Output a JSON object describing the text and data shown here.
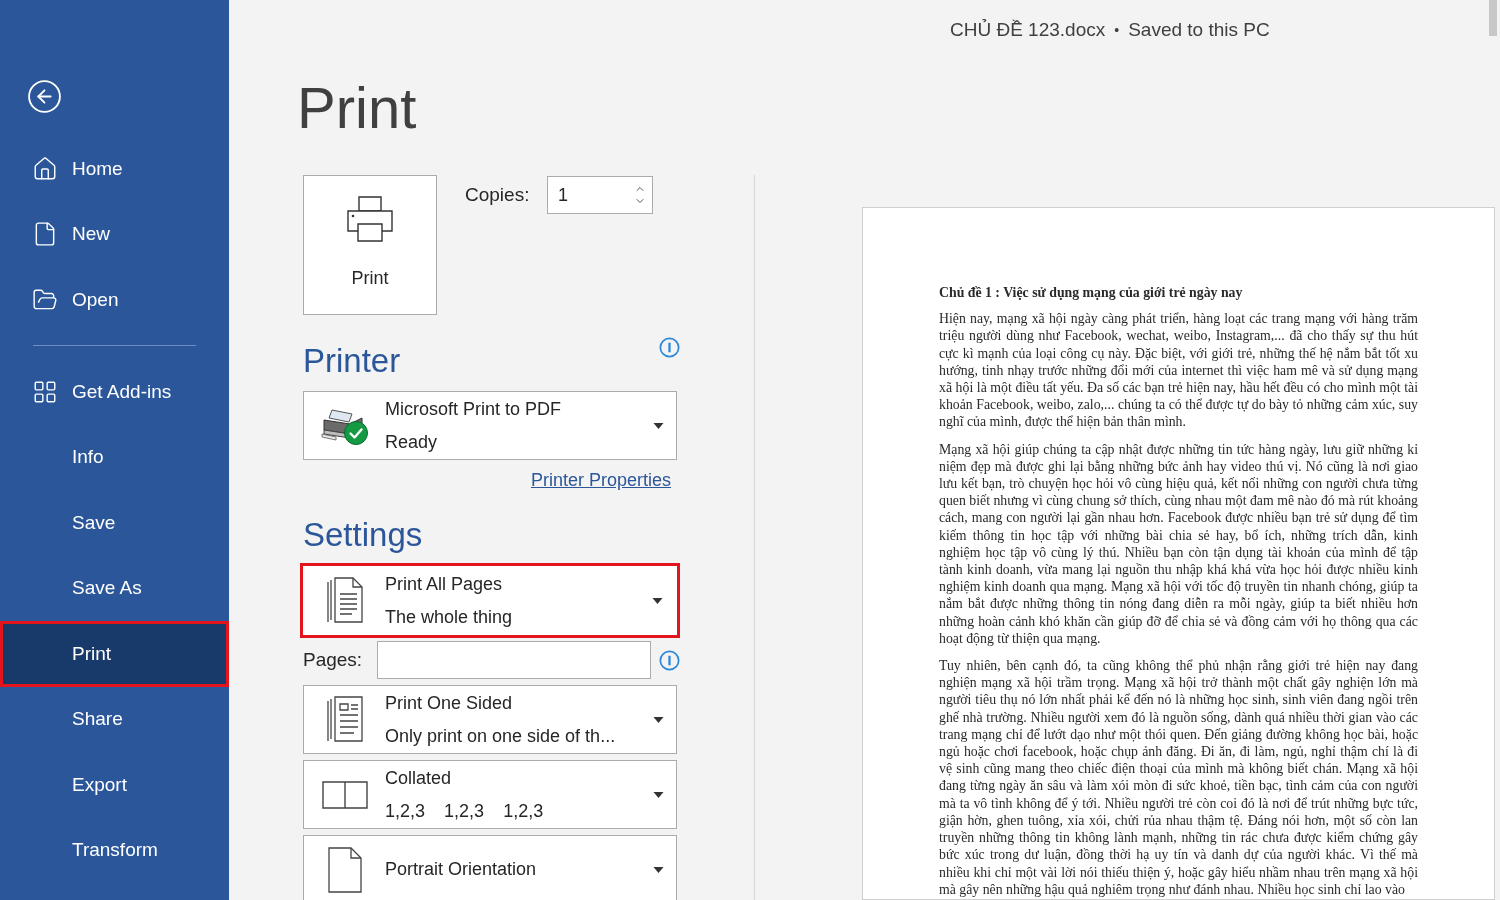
{
  "header": {
    "document_name": "CHỦ ĐỀ 123.docx",
    "separator": "•",
    "save_status": "Saved to this PC"
  },
  "sidebar": {
    "groups": [
      {
        "items": [
          {
            "kind": "home",
            "label": "Home",
            "selected": false,
            "highlighted": false
          },
          {
            "kind": "new",
            "label": "New",
            "selected": false,
            "highlighted": false
          },
          {
            "kind": "open",
            "label": "Open",
            "selected": false,
            "highlighted": false
          }
        ]
      },
      {
        "items": [
          {
            "kind": "add_ins",
            "label": "Get Add-ins",
            "selected": false,
            "highlighted": false
          },
          {
            "kind": "plain",
            "label": "Info",
            "selected": false,
            "highlighted": false
          },
          {
            "kind": "plain",
            "label": "Save",
            "selected": false,
            "highlighted": false
          },
          {
            "kind": "plain",
            "label": "Save As",
            "selected": false,
            "highlighted": false
          },
          {
            "kind": "plain",
            "label": "Print",
            "selected": true,
            "highlighted": true
          },
          {
            "kind": "plain",
            "label": "Share",
            "selected": false,
            "highlighted": false
          },
          {
            "kind": "plain",
            "label": "Export",
            "selected": false,
            "highlighted": false
          },
          {
            "kind": "plain",
            "label": "Transform",
            "selected": false,
            "highlighted": false
          }
        ]
      }
    ]
  },
  "print_panel": {
    "title": "Print",
    "print_button": "Print",
    "copies": {
      "label": "Copies:",
      "value": "1"
    },
    "printer": {
      "heading": "Printer",
      "name": "Microsoft Print to PDF",
      "status": "Ready",
      "properties_link": "Printer Properties"
    },
    "settings": {
      "heading": "Settings",
      "options": [
        {
          "kind": "pages",
          "title": "Print All Pages",
          "subtitle": "The whole thing",
          "highlighted": true
        },
        {
          "kind": "range",
          "label": "Pages:",
          "highlighted": false
        },
        {
          "kind": "sides",
          "title": "Print One Sided",
          "subtitle": "Only print on one side of th...",
          "highlighted": false
        },
        {
          "kind": "collation",
          "title": "Collated",
          "subtitle_parts": [
            "1,2,3",
            "1,2,3",
            "1,2,3"
          ],
          "highlighted": false
        },
        {
          "kind": "orientation",
          "title": "Portrait Orientation",
          "highlighted": false
        }
      ]
    }
  },
  "preview": {
    "heading": "Chủ đề 1 : Việc sử dụng mạng của giới trẻ ngày nay",
    "paragraphs": [
      "Hiện nay, mạng xã hội ngày càng phát triển, hàng loạt các trang mạng với hàng trăm triệu người dùng như Facebook, wechat, weibo, Instagram,... đã cho thấy sự thu hút cực kì mạnh của loại công cụ này. Đặc biệt, với giới trẻ, những thế hệ nắm bắt tốt xu hướng, tinh nhạy trước những đổi mới của internet thì việc ham mê và sử dụng mạng xã hội là một điều tất yếu. Đa số các bạn trẻ hiện nay, hầu hết đều có cho mình một tài khoản Facebook, weibo, zalo,... chúng ta có thể được tự do bày tỏ những cảm xúc, suy nghĩ của mình, được thể hiện bản thân mình.",
      "Mạng xã hội giúp chúng ta cập nhật được những tin tức hàng ngày, lưu giữ những kỉ niệm đẹp mà được ghi lại bằng những bức ảnh hay video thú vị. Nó cũng là nơi giao lưu kết bạn, trò chuyện học hỏi vô cùng hiệu quả, kết nối những con người chưa từng quen biết nhưng vì cùng chung sở thích, cùng nhau một đam mê nào đó mà rút khoảng cách, mang con người lại gần nhau hơn. Facebook được nhiều bạn trẻ sử dụng để tìm kiếm thông tin học tập với những bài chia sẻ hay, bổ ích, những trích dẫn, kinh nghiệm học tập vô cùng lý thú. Nhiều bạn còn tận dụng tài khoản của mình để tập tành kinh doanh, vừa mang lại nguồn thu nhập khá khá vừa học hỏi được nhiều kinh nghiệm kinh doanh qua mạng. Mạng xã hội với tốc độ truyền tin nhanh chóng, giúp ta nắm bắt được những thông tin nóng đang diễn ra mỗi ngày, giúp ta biết nhiều hơn những hoàn cảnh khó khăn cần giúp đỡ để chia sẻ và đồng cảm với họ thông qua các hoạt động từ thiện qua mạng.",
      "Tuy nhiên, bên cạnh đó, ta cũng không thể phủ nhận rằng giới trẻ hiện nay đang nghiện mạng xã hội trầm trọng. Mạng xã hội trở thành một chất gây nghiện lớn mà người tiêu thụ nó lớn nhất phải kể đến nó là những học sinh, sinh viên đang ngồi trên ghế nhà trường. Nhiều người xem đó là nguồn sống, dành quá nhiều thời gian vào các trang mạng chỉ để lướt dạo như một thói quen. Đến giảng đường không học bài, hoặc ngủ hoặc chơi facebook, hoặc chụp ảnh đăng. Đi ăn, đi làm, ngủ, nghỉ thậm chí là đi vệ sinh cũng mang theo chiếc điện thoại của mình mà không biết chán. Mạng xã hội đang từng ngày ăn sâu và làm xói mòn đi sức khoẻ, tiền bạc, tình cảm của con người mà ta vô tình không để ý tới. Nhiều người trẻ còn coi đó là nơi để trút những bực tức, giận hờn, ghen tuông, xỉa xói, chửi rủa nhau thậm tệ. Đáng nói hơn, một số còn lan truyền những thông tin không lành mạnh, những tin rác chưa được kiểm chứng gây bức xúc trong dư luận, đồng thời hạ uy tín và danh dự của người khác. Vì thế mà nhiều khi chỉ một vài lời nói thiếu thiện ý, hoặc gây hiểu nhầm nhau trên mạng xã hội mà gây nên những hậu quả nghiêm trọng như đánh nhau. Nhiều học sinh chỉ lao vào"
    ]
  }
}
